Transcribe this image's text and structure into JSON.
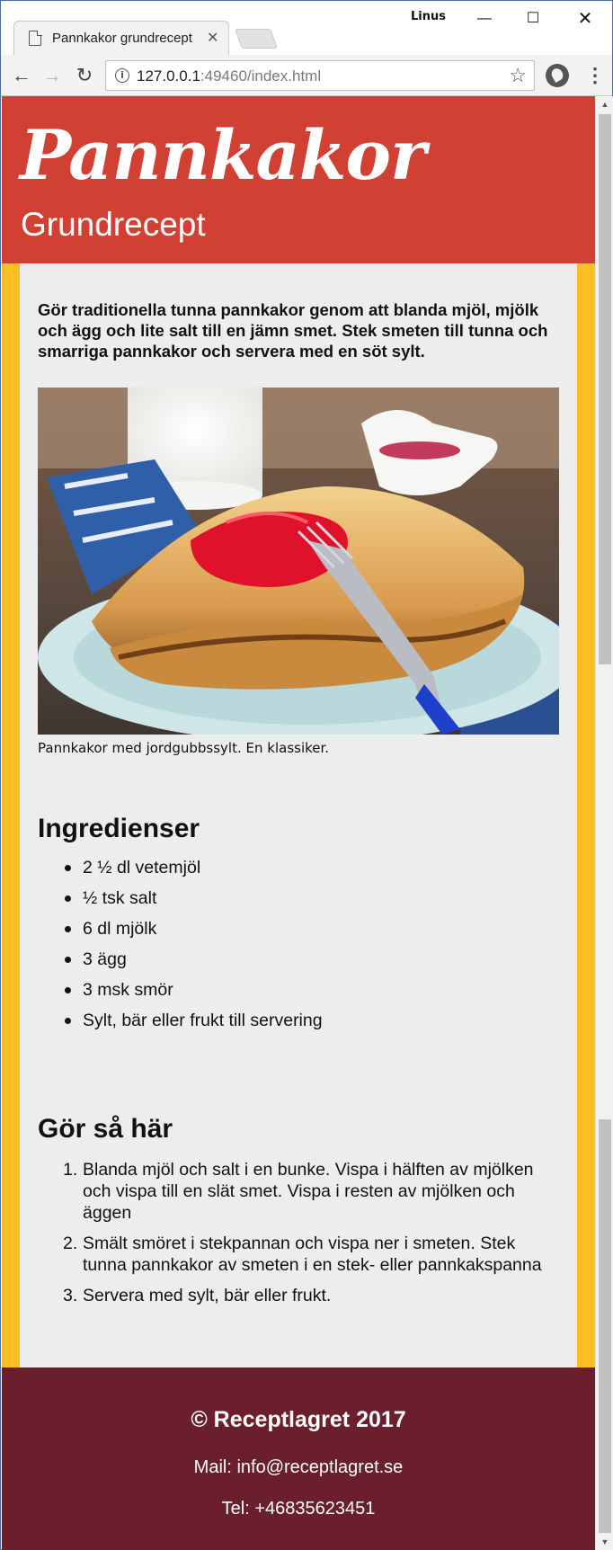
{
  "browser": {
    "tab_title": "Pannkakor grundrecept",
    "user_name": "Linus",
    "url_host": "127.0.0.1",
    "url_rest": ":49460/index.html"
  },
  "header": {
    "title": "Pannkakor",
    "subtitle": "Grundrecept"
  },
  "intro": "Gör traditionella tunna pannkakor genom att blanda mjöl, mjölk och ägg och lite salt till en jämn smet. Stek smeten till tunna och smarriga pannkakor och servera med en söt sylt.",
  "image": {
    "caption": "Pannkakor med jordgubbssylt. En klassiker."
  },
  "ingredients": {
    "heading": "Ingredienser",
    "items": [
      "2 ½ dl vetemjöl",
      "½ tsk salt",
      "6 dl mjölk",
      "3 ägg",
      "3 msk smör",
      "Sylt, bär eller frukt till servering"
    ]
  },
  "steps": {
    "heading": "Gör så här",
    "items": [
      {
        "num": "1.",
        "text": "Blanda mjöl och salt i en bunke. Vispa i hälften av mjölken och vispa till en slät smet. Vispa i resten av mjölken och äggen"
      },
      {
        "num": "2.",
        "text": "Smält smöret i stekpannan och vispa ner i smeten. Stek tunna pannkakor av smeten i en stek- eller pannkakspanna"
      },
      {
        "num": "3.",
        "text": "Servera med sylt, bär eller frukt."
      }
    ]
  },
  "footer": {
    "copyright": "© Receptlagret 2017",
    "mail": "Mail: info@receptlagret.se",
    "tel": "Tel: +46835623451"
  },
  "colors": {
    "header_bg": "#d14133",
    "side_bg": "#fbbf24",
    "main_bg": "#ededed",
    "footer_bg": "#6b1e2b"
  }
}
